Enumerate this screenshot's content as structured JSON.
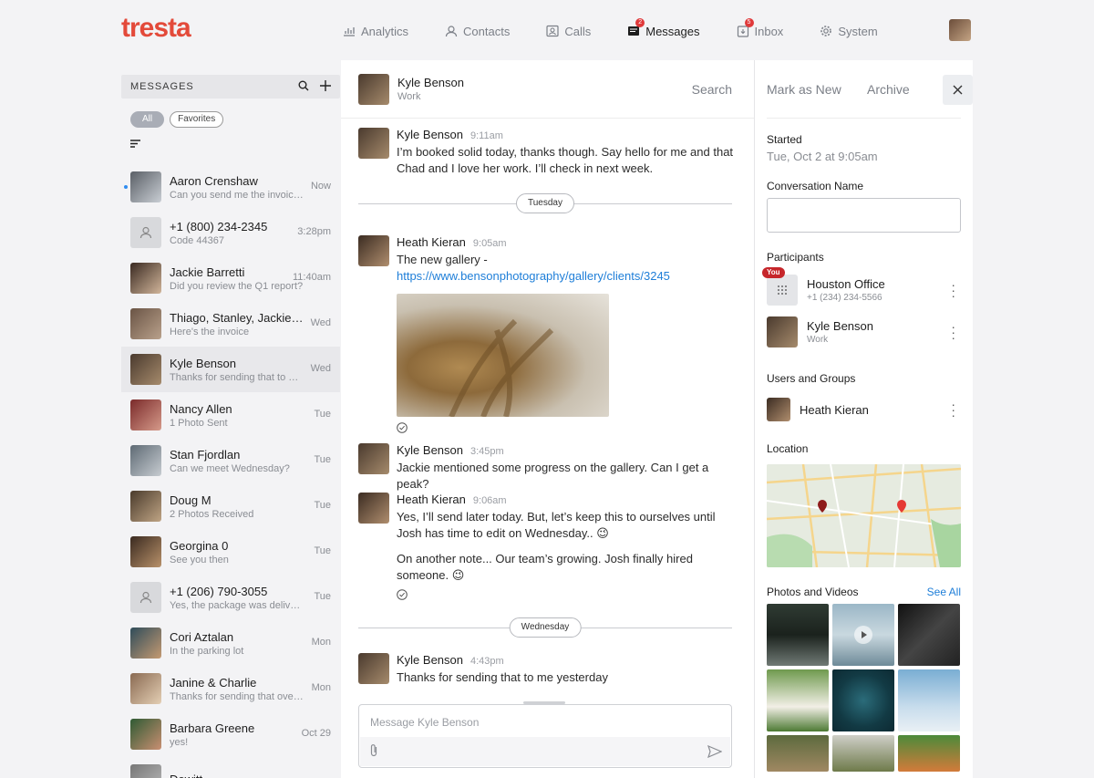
{
  "app": {
    "logo": "tresta",
    "colors": {
      "brand": "#e34a3a",
      "accent": "#1e7ed8",
      "badge": "#e0393a",
      "unread": "#2f8cf0"
    }
  },
  "nav": [
    {
      "label": "Analytics",
      "icon": "analytics-icon",
      "active": false
    },
    {
      "label": "Contacts",
      "icon": "contacts-icon",
      "active": false
    },
    {
      "label": "Calls",
      "icon": "calls-icon",
      "active": false
    },
    {
      "label": "Messages",
      "icon": "messages-icon",
      "active": true,
      "badge": "2"
    },
    {
      "label": "Inbox",
      "icon": "inbox-icon",
      "active": false,
      "badge": "5"
    },
    {
      "label": "System",
      "icon": "gear-icon",
      "active": false
    }
  ],
  "left": {
    "title": "MESSAGES",
    "filters": [
      "All",
      "Favorites"
    ],
    "conversations": [
      {
        "name": "Aaron Crenshaw",
        "preview": "Can you send me the invoice fo...",
        "time": "Now",
        "unread": true
      },
      {
        "name": "+1 (800) 234-2345",
        "preview": "Code 44367",
        "time": "3:28pm"
      },
      {
        "name": "Jackie Barretti",
        "preview": "Did you review the Q1 report?",
        "time": "11:40am"
      },
      {
        "name": "Thiago, Stanley, Jackie &...",
        "preview": "Here's the invoice",
        "time": "Wed"
      },
      {
        "name": "Kyle Benson",
        "preview": "Thanks for sending that to me y...",
        "time": "Wed",
        "selected": true
      },
      {
        "name": "Nancy Allen",
        "preview": "1 Photo Sent",
        "time": "Tue"
      },
      {
        "name": "Stan Fjordlan",
        "preview": "Can we meet Wednesday?",
        "time": "Tue"
      },
      {
        "name": "Doug M",
        "preview": "2 Photos Received",
        "time": "Tue"
      },
      {
        "name": "Georgina 0",
        "preview": "See you then",
        "time": "Tue"
      },
      {
        "name": "+1 (206) 790-3055",
        "preview": "Yes, the package was delivered.",
        "time": "Tue"
      },
      {
        "name": "Cori Aztalan",
        "preview": "In the parking lot",
        "time": "Mon"
      },
      {
        "name": "Janine & Charlie",
        "preview": "Thanks for sending that over, w...",
        "time": "Mon"
      },
      {
        "name": "Barbara Greene",
        "preview": "yes!",
        "time": "Oct 29"
      },
      {
        "name": "Dewitt",
        "preview": "",
        "time": ""
      }
    ]
  },
  "chat": {
    "contact_name": "Kyle Benson",
    "contact_sub": "Work",
    "search_label": "Search",
    "messages": [
      {
        "sender": "Kyle Benson",
        "time": "9:11am",
        "text": "I’m booked solid today, thanks though. Say hello for me and that Chad and I love her work. I’ll check in next week."
      },
      {
        "sender": "Heath Kieran",
        "time": "9:05am",
        "text": "The new gallery - ",
        "link": "https://www.bensonphotography/gallery/clients/3245"
      },
      {
        "sender": "Kyle Benson",
        "time": "3:45pm",
        "text": "Jackie mentioned some progress on the gallery. Can I get a peak?"
      },
      {
        "sender": "Heath Kieran",
        "time": "9:06am",
        "text": "Yes, I’ll send later today. But, let’s keep this to ourselves until Josh has time to edit on Wednesday..",
        "text2": "On another note... Our team’s growing. Josh finally hired someone."
      },
      {
        "sender": "Kyle Benson",
        "time": "4:43pm",
        "text": "Thanks for sending that to me yesterday"
      }
    ],
    "dividers": [
      "Tuesday",
      "Wednesday"
    ],
    "composer_placeholder": "Message Kyle Benson"
  },
  "right": {
    "mark_new": "Mark as New",
    "archive": "Archive",
    "started_label": "Started",
    "started_value": "Tue, Oct 2 at 9:05am",
    "conv_name_label": "Conversation Name",
    "participants_label": "Participants",
    "participants": [
      {
        "name": "Houston Office",
        "sub": "+1 (234) 234-5566",
        "you": "You"
      },
      {
        "name": "Kyle Benson",
        "sub": "Work"
      }
    ],
    "users_groups_label": "Users and Groups",
    "users": [
      {
        "name": "Heath Kieran"
      }
    ],
    "location_label": "Location",
    "photos_label": "Photos and Videos",
    "see_all": "See All"
  }
}
